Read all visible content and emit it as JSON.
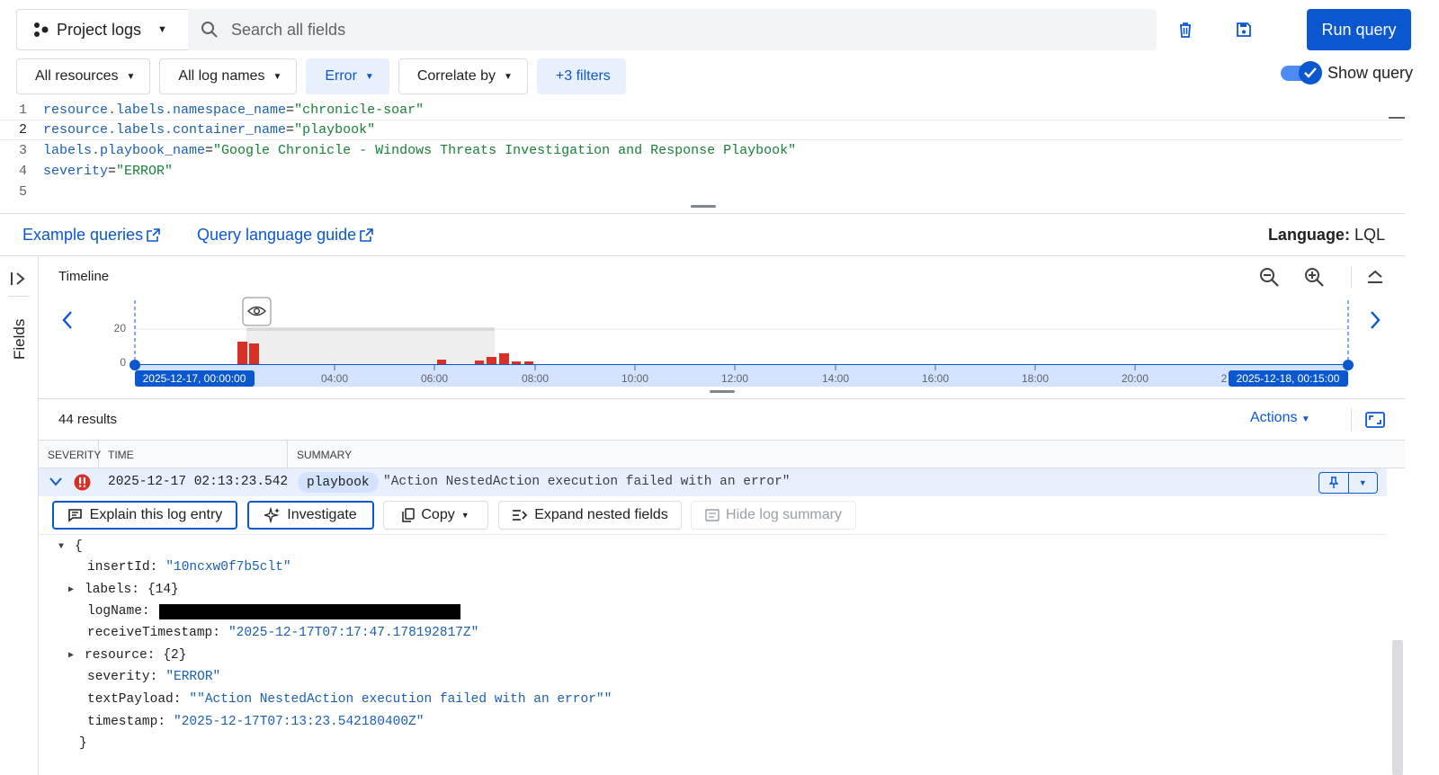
{
  "toolbar": {
    "project_label": "Project logs",
    "search_placeholder": "Search all fields",
    "run_label": "Run query",
    "icons": [
      "project-nodes-icon",
      "search-icon",
      "delete-icon",
      "save-icon"
    ]
  },
  "filters": {
    "resources": "All resources",
    "log_names": "All log names",
    "severity": "Error",
    "correlate": "Correlate by",
    "more": "+3 filters",
    "show_query": "Show query"
  },
  "editor": {
    "lines": [
      {
        "n": "1",
        "key": "resource.labels.namespace_name",
        "op": "=",
        "val": "\"chronicle-soar\""
      },
      {
        "n": "2",
        "key": "resource.labels.container_name",
        "op": "=",
        "val": "\"playbook\""
      },
      {
        "n": "3",
        "key": "labels.playbook_name",
        "op": "=",
        "val": "\"Google Chronicle - Windows Threats Investigation and Response Playbook\""
      },
      {
        "n": "4",
        "key": "severity",
        "op": "=",
        "val": "\"ERROR\""
      },
      {
        "n": "5",
        "key": "",
        "op": "",
        "val": ""
      }
    ]
  },
  "links": {
    "examples": "Example queries",
    "guide": "Query language guide",
    "language_label": "Language:",
    "language_value": "LQL"
  },
  "side": {
    "fields_label": "Fields"
  },
  "timeline": {
    "title": "Timeline",
    "start_label": "2025-12-17, 00:00:00",
    "end_label": "2025-12-18, 00:15:00",
    "y_ticks": [
      "20",
      "0"
    ],
    "x_ticks": [
      "04:00",
      "06:00",
      "08:00",
      "10:00",
      "12:00",
      "14:00",
      "16:00",
      "18:00",
      "20:00",
      "2"
    ],
    "bar_color": "#d93025",
    "accent": "#0b57d0"
  },
  "results": {
    "count": "44 results",
    "actions_label": "Actions",
    "columns": [
      "SEVERITY",
      "TIME",
      "SUMMARY"
    ],
    "row": {
      "time": "2025-12-17 02:13:23.542",
      "container": "playbook",
      "message": "\"Action NestedAction execution failed with an error\""
    },
    "entry_actions": {
      "explain": "Explain this log entry",
      "investigate": "Investigate",
      "copy": "Copy",
      "expand": "Expand nested fields",
      "hide": "Hide log summary"
    }
  },
  "entry": {
    "open_brace": "{",
    "close_brace": "}",
    "insertId_key": "insertId:",
    "insertId_val": "\"10ncxw0f7b5clt\"",
    "labels_key": "labels:",
    "labels_val": "{14}",
    "logName_key": "logName:",
    "receive_key": "receiveTimestamp:",
    "receive_val": "\"2025-12-17T07:17:47.178192817Z\"",
    "resource_key": "resource:",
    "resource_val": "{2}",
    "severity_key": "severity:",
    "severity_val": "\"ERROR\"",
    "text_key": "textPayload:",
    "text_val": "\"\"Action NestedAction execution failed with an error\"\"",
    "ts_key": "timestamp:",
    "ts_val": "\"2025-12-17T07:13:23.542180400Z\""
  }
}
